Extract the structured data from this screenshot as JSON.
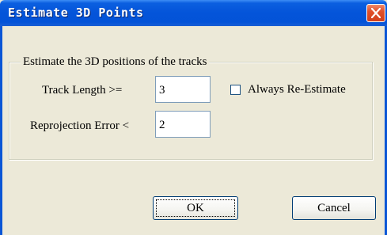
{
  "window": {
    "title": "Estimate 3D Points"
  },
  "group": {
    "legend": "Estimate the 3D positions of the tracks"
  },
  "track_length": {
    "label": "Track Length >=",
    "value": "3"
  },
  "always_reestimate": {
    "label": "Always Re-Estimate",
    "checked": false
  },
  "reprojection_error": {
    "label": "Reprojection Error <",
    "value": "2"
  },
  "buttons": {
    "ok": "OK",
    "cancel": "Cancel"
  }
}
